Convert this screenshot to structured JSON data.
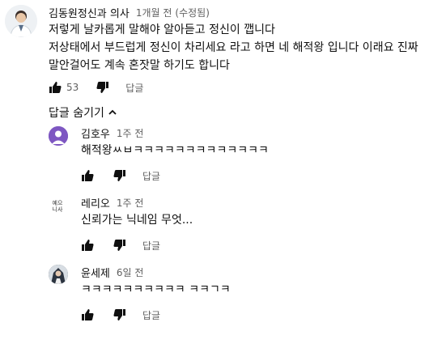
{
  "comment": {
    "author": "김동원정신과 의사",
    "time": "1개월 전",
    "edited": "(수정됨)",
    "lines": [
      "저렇게 날카롭게 말해야 알아듣고 정신이 깹니다",
      "저상태에서 부드럽게 정신이 차리세요 라고 하면 네 해적왕 입니다 이래요 진짜",
      "말안걸어도 계속 혼잣말 하기도 합니다"
    ],
    "like_count": "53",
    "reply_label": "답글"
  },
  "replies_toggle": {
    "label": "답글 숨기기"
  },
  "replies": [
    {
      "author": "김호우",
      "time": "1주 전",
      "text": "해적왕ㅆㅂㅋㅋㅋㅋㅋㅋㅋㅋㅋㅋㅋㅋㅋ",
      "reply_label": "답글"
    },
    {
      "author": "레리오",
      "time": "1주 전",
      "text": "신뢰가는 닉네임 무엇...",
      "reply_label": "답글",
      "avatar_text": [
        "예으",
        "니사"
      ]
    },
    {
      "author": "윤세제",
      "time": "6일 전",
      "text": "ㅋㅋㅋㅋㅋㅋㅋㅋㅋㅋ ㅋㅋㄱㅋ",
      "reply_label": "답글"
    }
  ],
  "colors": {
    "accent_avatar": "#7e57c2",
    "text_primary": "#0f0f0f",
    "text_secondary": "#606060"
  },
  "icons": {
    "like": "thumb-up-icon",
    "dislike": "thumb-down-icon",
    "collapse": "chevron-up-icon"
  }
}
